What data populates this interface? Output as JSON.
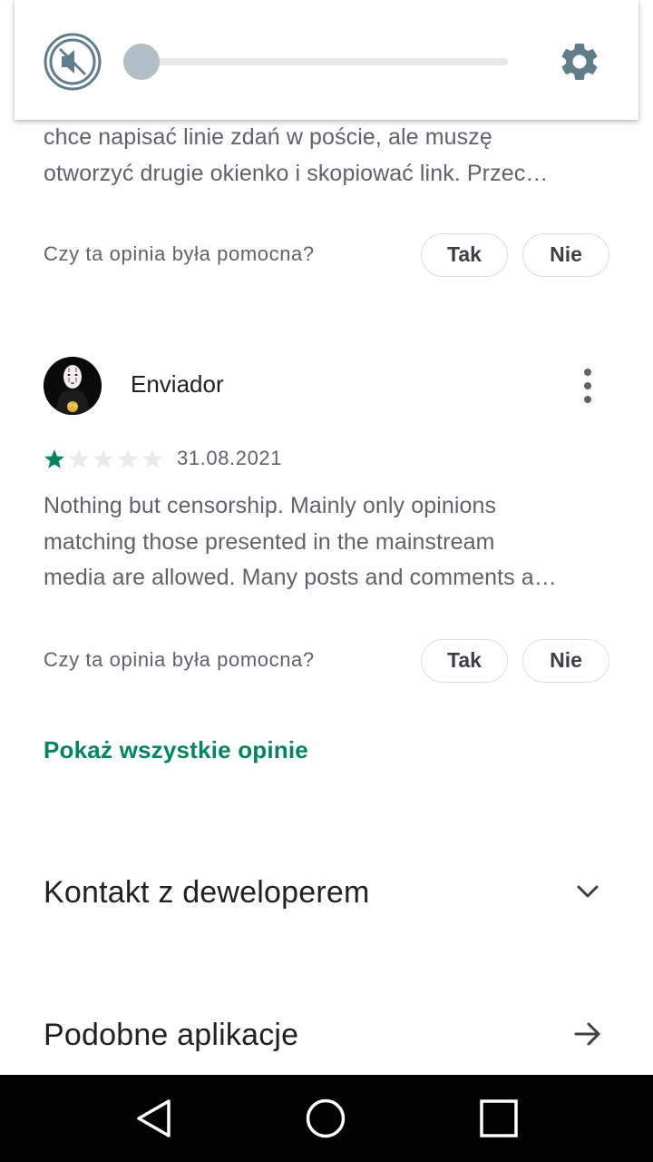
{
  "volume_panel": {
    "mute_icon": "volume-off-icon",
    "settings_icon": "gear-icon",
    "volume_level": 0,
    "accent_color": "#b0bec5",
    "icon_color": "#607d8b"
  },
  "previous_review": {
    "text_lines": [
      "chce napisać linie zdań w poście, ale muszę",
      "otworzyć drugie okienko i skopiować link. Przec…"
    ],
    "helpful_question": "Czy ta opinia była pomocna?",
    "yes_label": "Tak",
    "no_label": "Nie"
  },
  "review": {
    "author": "Enviador",
    "rating": 1,
    "max_rating": 5,
    "date": "31.08.2021",
    "text_lines": [
      "Nothing but censorship. Mainly only opinions",
      "matching those presented in the mainstream",
      "media are allowed. Many posts and comments a…"
    ],
    "helpful_question": "Czy ta opinia była pomocna?",
    "yes_label": "Tak",
    "no_label": "Nie",
    "more_icon": "more-vertical-icon",
    "star_color": "#01875f"
  },
  "show_all_reviews": "Pokaż wszystkie opinie",
  "sections": {
    "developer_contact": {
      "title": "Kontakt z deweloperem",
      "icon": "chevron-down-icon"
    },
    "similar_apps": {
      "title": "Podobne aplikacje",
      "icon": "arrow-right-icon"
    }
  },
  "navbar": {
    "back_icon": "back-triangle-icon",
    "home_icon": "home-circle-icon",
    "recents_icon": "recents-square-icon"
  }
}
